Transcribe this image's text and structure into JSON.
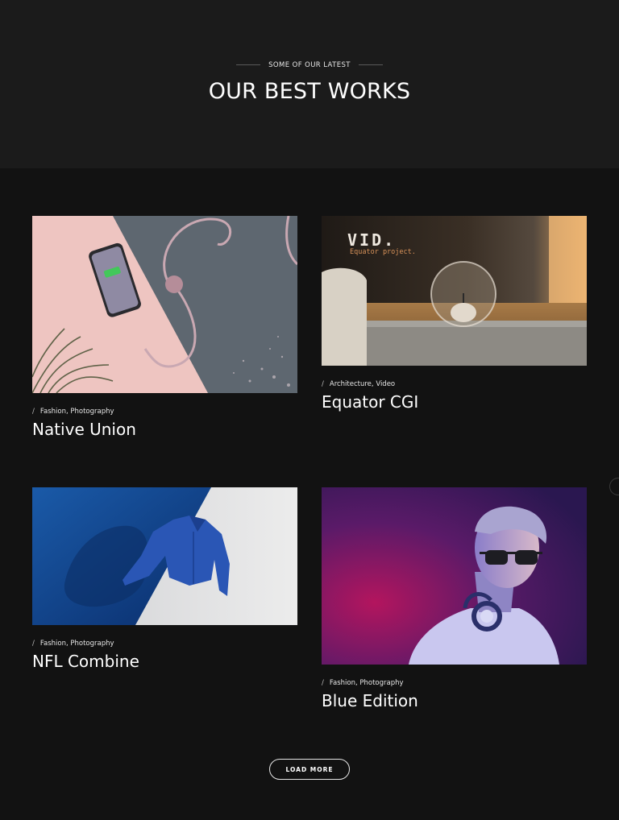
{
  "header": {
    "eyebrow": "SOME OF OUR LATEST",
    "title": "OUR BEST WORKS"
  },
  "projects": [
    {
      "title": "Native Union",
      "categories": "Fashion, Photography",
      "image": "phone-charger-on-pink-and-grey"
    },
    {
      "title": "Equator CGI",
      "categories": "Architecture, Video",
      "image": "glass-candle-sphere-render",
      "overlay_title": "VID.",
      "overlay_subtitle": "Equator project."
    },
    {
      "title": "NFL Combine",
      "categories": "Fashion, Photography",
      "image": "floating-blue-jacket"
    },
    {
      "title": "Blue Edition",
      "categories": "Fashion, Photography",
      "image": "man-with-sunglasses-and-headphones"
    }
  ],
  "load_more": {
    "label": "LOAD MORE"
  },
  "colors": {
    "background": "#121212",
    "hero_background": "#1b1b1b",
    "text": "#ffffff"
  }
}
